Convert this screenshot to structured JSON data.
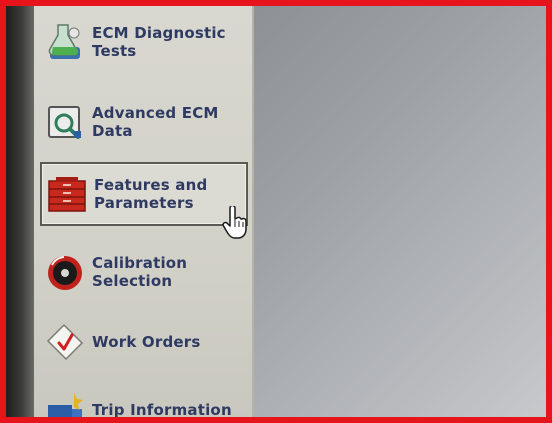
{
  "sidebar": {
    "items": [
      {
        "label": "ECM Diagnostic\nTests",
        "icon": "flask-icon"
      },
      {
        "label": "Advanced ECM\nData",
        "icon": "magnifier-icon"
      },
      {
        "label": "Features and\nParameters",
        "icon": "toolbox-icon",
        "selected": true
      },
      {
        "label": "Calibration\nSelection",
        "icon": "disc-icon"
      },
      {
        "label": "Work Orders",
        "icon": "checklist-icon"
      },
      {
        "label": "Trip Information",
        "icon": "truck-icon"
      }
    ]
  },
  "colors": {
    "frame_border": "#e8141c",
    "label_text": "#2f3a63",
    "sidebar_bg": "#d6d5cd",
    "pane_bg": "#9ea2a7"
  }
}
